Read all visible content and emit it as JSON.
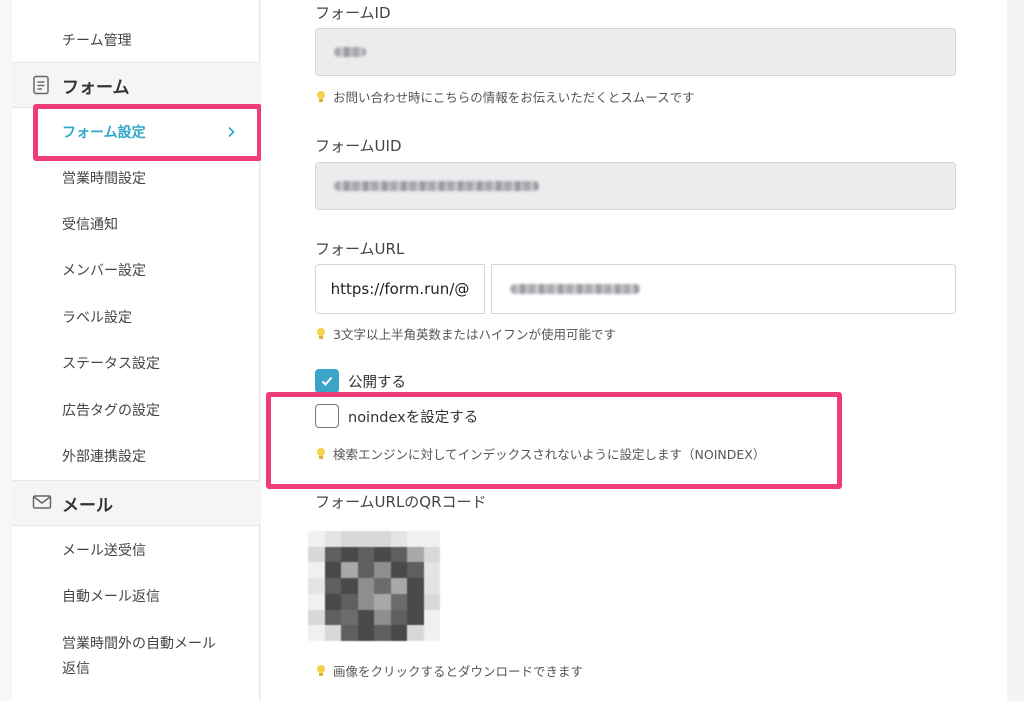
{
  "sidebar": {
    "team_item": "チーム管理",
    "section_form": "フォーム",
    "form_items": [
      "フォーム設定",
      "営業時間設定",
      "受信通知",
      "メンバー設定",
      "ラベル設定",
      "ステータス設定",
      "広告タグの設定",
      "外部連携設定"
    ],
    "section_mail": "メール",
    "mail_items": [
      "メール送受信",
      "自動メール返信",
      "営業時間外の自動メール",
      "返信"
    ]
  },
  "main": {
    "form_id_label": "フォームID",
    "form_id_hint": "お問い合わせ時にこちらの情報をお伝えいただくとスムースです",
    "form_uid_label": "フォームUID",
    "form_url_label": "フォームURL",
    "form_url_prefix": "https://form.run/@",
    "form_url_hint": "3文字以上半角英数またはハイフンが使用可能です",
    "publish_label": "公開する",
    "publish_checked": true,
    "noindex_label": "noindexを設定する",
    "noindex_checked": false,
    "noindex_hint": "検索エンジンに対してインデックスされないように設定します（NOINDEX）",
    "qr_label": "フォームURLのQRコード",
    "qr_hint": "画像をクリックするとダウンロードできます"
  },
  "colors": {
    "accent": "#2ea7c9",
    "highlight": "#f03c78",
    "checkbox": "#3aa5c8"
  }
}
